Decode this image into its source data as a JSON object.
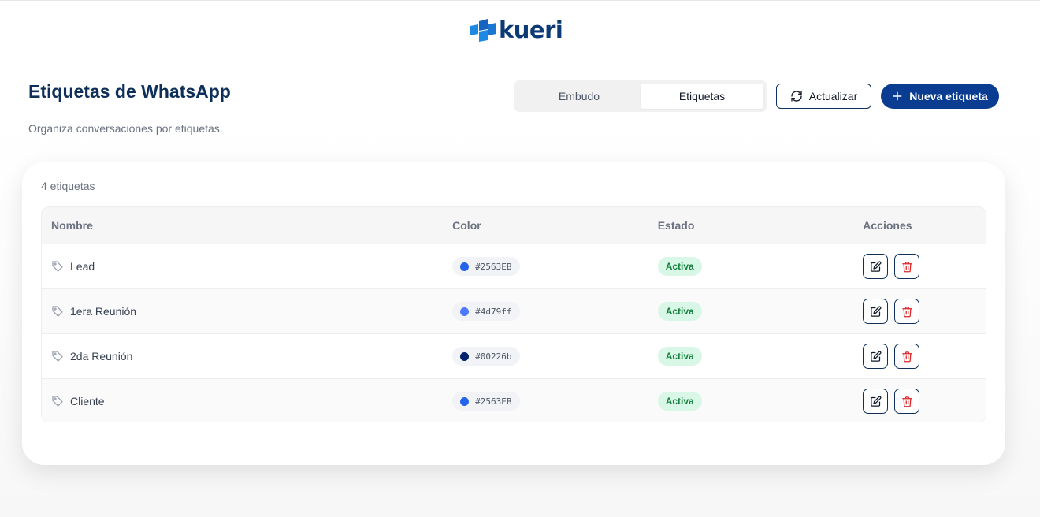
{
  "brand": {
    "name": "kueri",
    "accent": "#0a3d91",
    "mark_color": "#1e88e5"
  },
  "header": {
    "title": "Etiquetas de WhatsApp",
    "subtitle": "Organiza conversaciones por etiquetas."
  },
  "view_switch": {
    "tabs": [
      {
        "label": "Embudo",
        "active": false
      },
      {
        "label": "Etiquetas",
        "active": true
      }
    ]
  },
  "actions": {
    "refresh_label": "Actualizar",
    "new_label": "Nueva etiqueta"
  },
  "list": {
    "count_label": "4 etiquetas",
    "columns": [
      "Nombre",
      "Color",
      "Estado",
      "Acciones"
    ],
    "rows": [
      {
        "name": "Lead",
        "color_hex": "#2563EB",
        "color_label": "#2563EB",
        "status": "Activa"
      },
      {
        "name": "1era Reunión",
        "color_hex": "#4d79ff",
        "color_label": "#4d79ff",
        "status": "Activa"
      },
      {
        "name": "2da Reunión",
        "color_hex": "#00226b",
        "color_label": "#00226b",
        "status": "Activa"
      },
      {
        "name": "Cliente",
        "color_hex": "#2563EB",
        "color_label": "#2563EB",
        "status": "Activa"
      }
    ]
  },
  "icons": {
    "tag": "tag-icon",
    "edit": "edit-icon",
    "delete": "trash-icon",
    "refresh": "refresh-icon",
    "add": "plus-icon"
  },
  "colors": {
    "status_active_bg": "#d9f7e6",
    "status_active_fg": "#15803d",
    "delete_icon": "#dc2626"
  }
}
